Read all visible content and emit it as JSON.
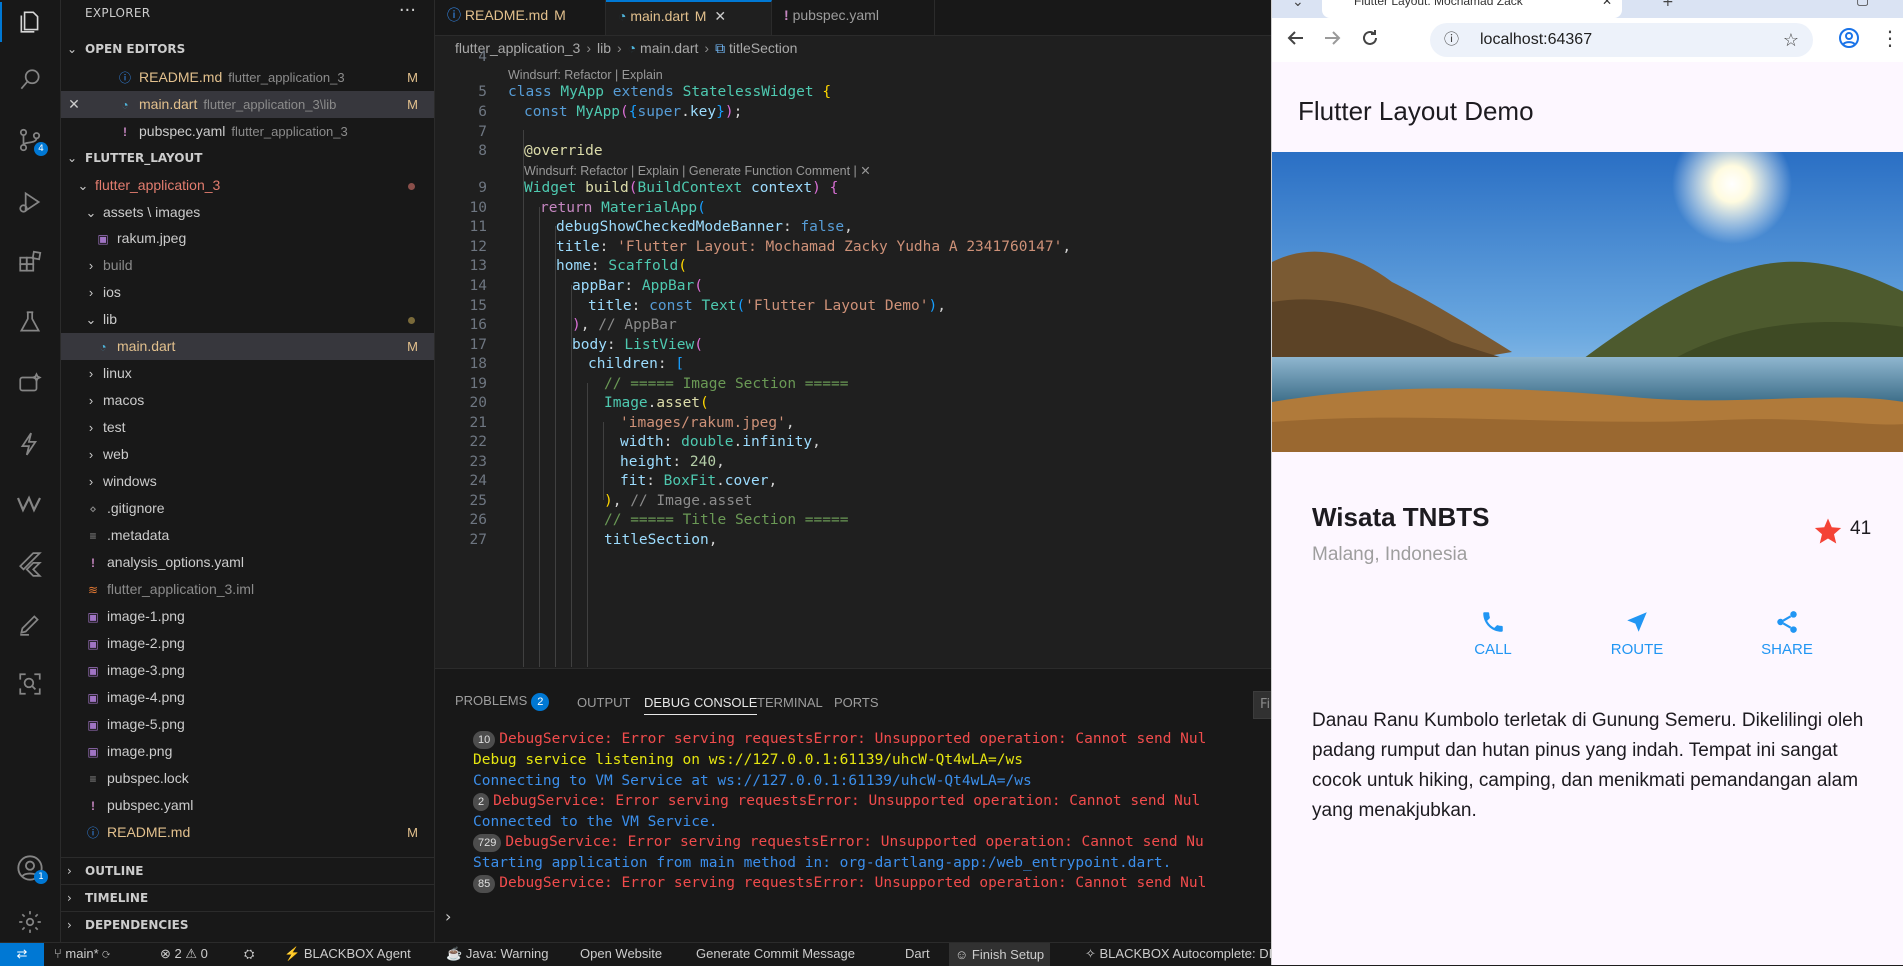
{
  "activity_bar": {
    "items": [
      "files-icon",
      "search-icon",
      "source-control-icon",
      "run-debug-icon",
      "extensions-icon",
      "testing-icon",
      "ai-sparkle-icon",
      "lightning-icon",
      "windsurf-icon",
      "flutter-icon",
      "pen-icon",
      "screen-search-icon"
    ],
    "source_control_badge": "4",
    "accounts_badge": "1"
  },
  "sidebar": {
    "title": "EXPLORER",
    "more": "···",
    "open_editors_header": "OPEN EDITORS",
    "open_editors": [
      {
        "name": "README.md",
        "desc": "flutter_application_3",
        "status": "M"
      },
      {
        "name": "main.dart",
        "desc": "flutter_application_3\\lib",
        "status": "M"
      },
      {
        "name": "pubspec.yaml",
        "desc": "flutter_application_3",
        "status": ""
      }
    ],
    "workspace_header": "FLUTTER_LAYOUT",
    "tree": [
      {
        "name": "flutter_application_3"
      },
      {
        "name": "assets \\ images"
      },
      {
        "name": "rakum.jpeg"
      },
      {
        "name": "build"
      },
      {
        "name": "ios"
      },
      {
        "name": "lib"
      },
      {
        "name": "main.dart",
        "status": "M"
      },
      {
        "name": "linux"
      },
      {
        "name": "macos"
      },
      {
        "name": "test"
      },
      {
        "name": "web"
      },
      {
        "name": "windows"
      },
      {
        "name": ".gitignore"
      },
      {
        "name": ".metadata"
      },
      {
        "name": "analysis_options.yaml"
      },
      {
        "name": "flutter_application_3.iml"
      },
      {
        "name": "image-1.png"
      },
      {
        "name": "image-2.png"
      },
      {
        "name": "image-3.png"
      },
      {
        "name": "image-4.png"
      },
      {
        "name": "image-5.png"
      },
      {
        "name": "image.png"
      },
      {
        "name": "pubspec.lock"
      },
      {
        "name": "pubspec.yaml"
      },
      {
        "name": "README.md",
        "status": "M"
      }
    ],
    "outline_header": "OUTLINE",
    "timeline_header": "TIMELINE",
    "dependencies_header": "DEPENDENCIES"
  },
  "editor": {
    "tabs": [
      {
        "name": "README.md",
        "status": "M"
      },
      {
        "name": "main.dart",
        "status": "M",
        "close": "✕"
      },
      {
        "name": "pubspec.yaml",
        "status": ""
      }
    ],
    "breadcrumb": [
      "flutter_application_3",
      "lib",
      "main.dart",
      "titleSection"
    ],
    "code_lens_1": "Windsurf: Refactor | Explain",
    "code_lens_2": "Windsurf: Refactor | Explain | Generate Function Comment | ✕",
    "line_numbers": [
      "4",
      "5",
      "6",
      "7",
      "8",
      "9",
      "10",
      "11",
      "12",
      "13",
      "14",
      "15",
      "16",
      "17",
      "18",
      "19",
      "20",
      "21",
      "22",
      "23",
      "24",
      "25",
      "26",
      "27"
    ],
    "title_string": "'Flutter Layout: Mochamad Zacky Yudha A 2341760147'",
    "appbar_string": "'Flutter Layout Demo'",
    "image_string": "'images/rakum.jpeg'",
    "height_value": "240",
    "comment_image": "// ===== Image Section =====",
    "comment_title": "// ===== Title Section =====",
    "hint_appbar": "// AppBar",
    "hint_image": "// Image.asset"
  },
  "panel": {
    "tabs": [
      "PROBLEMS",
      "OUTPUT",
      "DEBUG CONSOLE",
      "TERMINAL",
      "PORTS"
    ],
    "problems_count": "2",
    "filter_placeholder": "Fil",
    "lines": [
      {
        "count": "10",
        "text": "DebugService: Error serving requestsError: Unsupported operation: Cannot send Nul",
        "type": "err"
      },
      {
        "count": "",
        "text": "Debug service listening on ws://127.0.0.1:61139/uhcW-Qt4wLA=/ws",
        "type": "warn"
      },
      {
        "count": "",
        "text": "Connecting to VM Service at ws://127.0.0.1:61139/uhcW-Qt4wLA=/ws",
        "type": "info"
      },
      {
        "count": "2",
        "text": "DebugService: Error serving requestsError: Unsupported operation: Cannot send Nul",
        "type": "err"
      },
      {
        "count": "",
        "text": "Connected to the VM Service.",
        "type": "info"
      },
      {
        "count": "729",
        "text": "DebugService: Error serving requestsError: Unsupported operation: Cannot send Nu",
        "type": "err"
      },
      {
        "count": "",
        "text": "Starting application from main method in: org-dartlang-app:/web_entrypoint.dart.",
        "type": "info"
      },
      {
        "count": "85",
        "text": "DebugService: Error serving requestsError: Unsupported operation: Cannot send Nul",
        "type": "err"
      }
    ],
    "prompt": "›"
  },
  "status_bar": {
    "branch": "main*",
    "errors": "2",
    "warnings": "0",
    "blackbox_agent": "BLACKBOX Agent",
    "java": "Java: Warning",
    "open_website": "Open Website",
    "commit_msg": "Generate Commit Message",
    "language": "Dart",
    "finish_setup": "Finish Setup",
    "autocomplete": "BLACKBOX Autocomplete: DIS"
  },
  "browser": {
    "tab_title": "Flutter Layout: Mochamad Zack",
    "url": "localhost:64367",
    "appbar_title": "Flutter Layout Demo",
    "place_name": "Wisata TNBTS",
    "place_location": "Malang, Indonesia",
    "rating": "41",
    "actions": [
      "CALL",
      "ROUTE",
      "SHARE"
    ],
    "description": "Danau Ranu Kumbolo terletak di Gunung Semeru. Dikelilingi oleh padang rumput dan hutan pinus yang indah. Tempat ini sangat cocok untuk hiking, camping, dan menikmati pemandangan alam yang menakjubkan.",
    "accent_color": "#2196f3",
    "star_color": "#f44336"
  }
}
